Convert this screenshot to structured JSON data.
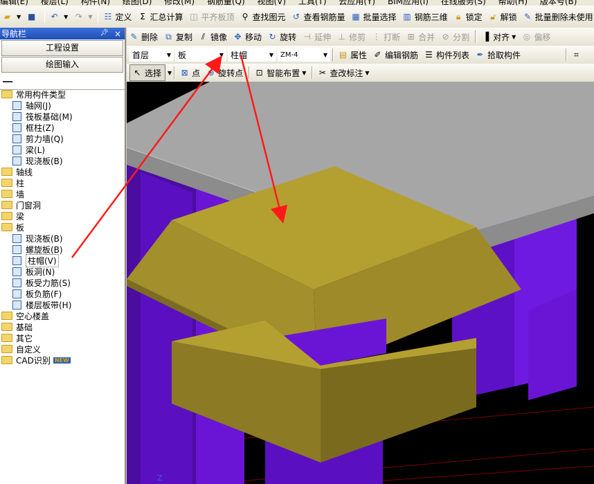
{
  "menu": {
    "items": [
      "编辑(E)",
      "楼层(L)",
      "构件(N)",
      "绘图(D)",
      "修改(M)",
      "钢筋量(Q)",
      "视图(V)",
      "工具(T)",
      "云应用(Y)",
      "BIM应用(I)",
      "在线服务(S)",
      "帮助(H)",
      "版本号(B)"
    ]
  },
  "toolbar1": {
    "define": "定义",
    "sum": "汇总计算",
    "flat_slab": "平齐板顶",
    "find": "查找图元",
    "view_rebar": "查看钢筋量",
    "batch_select": "批量选择",
    "rebar_3d": "钢筋三维",
    "lock": "锁定",
    "unlock": "解锁",
    "batch_delete": "批量删除未使用"
  },
  "toolbar2": {
    "delete": "删除",
    "copy": "复制",
    "mirror": "镜像",
    "move": "移动",
    "rotate": "旋转",
    "extend": "延伸",
    "trim": "修剪",
    "break": "打断",
    "merge": "合并",
    "split": "分割",
    "align": "对齐",
    "offset": "偏移"
  },
  "toolbar3": {
    "floor": "首层",
    "category": "板",
    "type": "柱帽",
    "component": "ZM-4",
    "property": "属性",
    "edit_rebar": "编辑钢筋",
    "component_list": "构件列表",
    "pick_component": "拾取构件"
  },
  "toolbar4": {
    "select": "选择",
    "point": "点",
    "rotate_point": "旋转点",
    "smart_layout": "智能布置",
    "modify_label": "查改标注"
  },
  "nav": {
    "title": "导航栏",
    "pin": "ᚠ",
    "close": "×",
    "project_settings": "工程设置",
    "drawing_input": "绘图输入",
    "tree": [
      {
        "label": "常用构件类型",
        "level": 0,
        "kind": "folder"
      },
      {
        "label": "轴网(J)",
        "level": 1,
        "kind": "leaf"
      },
      {
        "label": "筏板基础(M)",
        "level": 1,
        "kind": "leaf"
      },
      {
        "label": "框柱(Z)",
        "level": 1,
        "kind": "leaf"
      },
      {
        "label": "剪力墙(Q)",
        "level": 1,
        "kind": "leaf"
      },
      {
        "label": "梁(L)",
        "level": 1,
        "kind": "leaf"
      },
      {
        "label": "现浇板(B)",
        "level": 1,
        "kind": "leaf"
      },
      {
        "label": "轴线",
        "level": 0,
        "kind": "folder"
      },
      {
        "label": "柱",
        "level": 0,
        "kind": "folder"
      },
      {
        "label": "墙",
        "level": 0,
        "kind": "folder"
      },
      {
        "label": "门窗洞",
        "level": 0,
        "kind": "folder"
      },
      {
        "label": "梁",
        "level": 0,
        "kind": "folder"
      },
      {
        "label": "板",
        "level": 0,
        "kind": "folder"
      },
      {
        "label": "现浇板(B)",
        "level": 1,
        "kind": "leaf"
      },
      {
        "label": "螺旋板(B)",
        "level": 1,
        "kind": "leaf"
      },
      {
        "label": "柱帽(V)",
        "level": 1,
        "kind": "leaf",
        "selected": true
      },
      {
        "label": "板洞(N)",
        "level": 1,
        "kind": "leaf"
      },
      {
        "label": "板受力筋(S)",
        "level": 1,
        "kind": "leaf"
      },
      {
        "label": "板负筋(F)",
        "level": 1,
        "kind": "leaf"
      },
      {
        "label": "楼层板带(H)",
        "level": 1,
        "kind": "leaf"
      },
      {
        "label": "空心楼盖",
        "level": 0,
        "kind": "folder"
      },
      {
        "label": "基础",
        "level": 0,
        "kind": "folder"
      },
      {
        "label": "其它",
        "level": 0,
        "kind": "folder"
      },
      {
        "label": "自定义",
        "level": 0,
        "kind": "folder"
      },
      {
        "label": "CAD识别",
        "level": 0,
        "kind": "folder",
        "badge": "NEW"
      }
    ]
  },
  "viewport": {
    "axis_label": "Z",
    "colors": {
      "background": "#000000",
      "slab": "#a6a6a6",
      "column": "#5a0fb8",
      "cap": "#b4a030"
    }
  }
}
